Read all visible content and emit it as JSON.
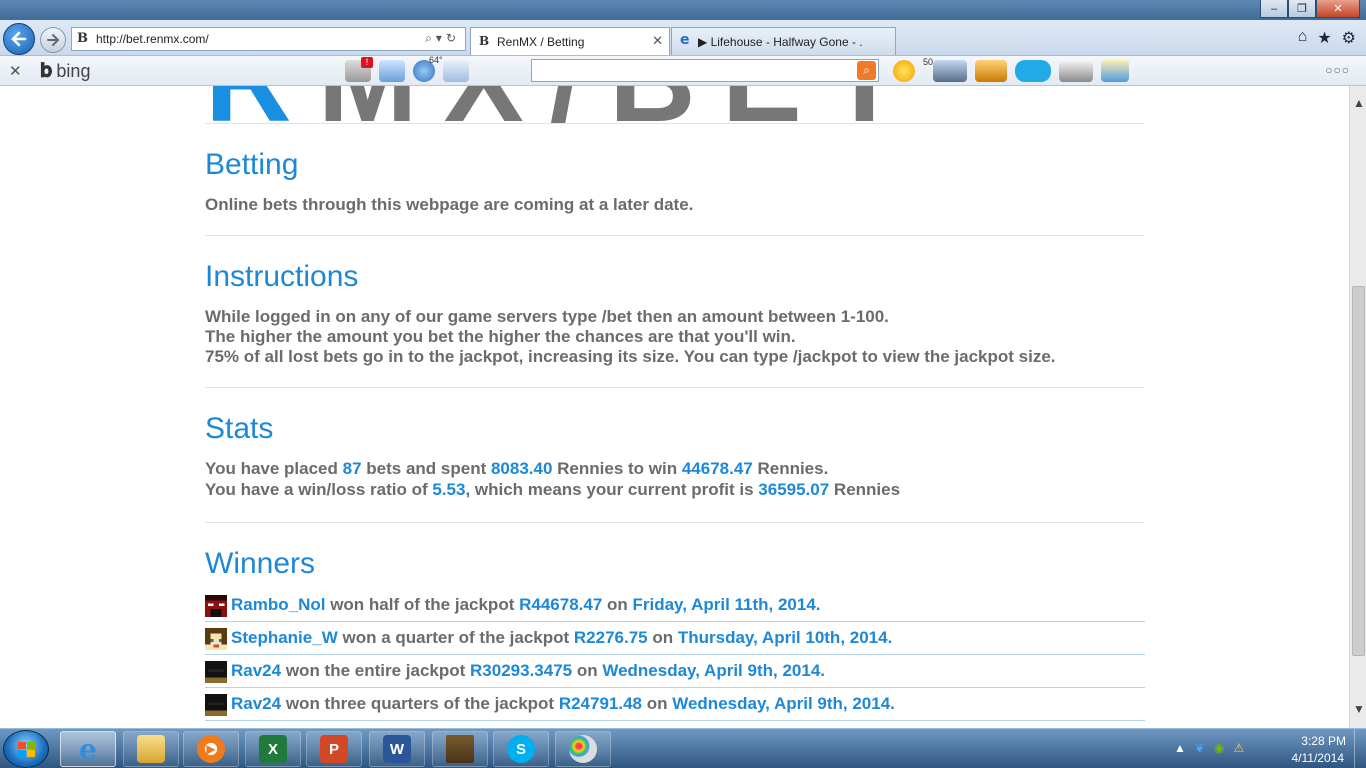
{
  "browser": {
    "address": "http://bet.renmx.com/",
    "tabs": [
      {
        "label": "RenMX / Betting"
      },
      {
        "label": "▶ Lifehouse - Halfway Gone - ..."
      }
    ],
    "toolbar_brand": "bing",
    "weather_temp": "64°",
    "badge_count": "50"
  },
  "page": {
    "sections": {
      "betting": {
        "title": "Betting",
        "text": "Online bets through this webpage are coming at a later date."
      },
      "instructions": {
        "title": "Instructions",
        "lines": [
          "While logged in on any of our game servers type /bet then an amount between 1-100.",
          "The higher the amount you bet the higher the chances are that you'll win.",
          "75% of all lost bets go in to the jackpot, increasing its size. You can type /jackpot to view the jackpot size."
        ]
      },
      "stats": {
        "title": "Stats",
        "line1": {
          "a": "You have placed ",
          "bets": "87",
          "b": " bets and spent ",
          "spent": "8083.40",
          "c": " Rennies to win ",
          "won": "44678.47",
          "d": " Rennies."
        },
        "line2": {
          "a": "You have a win/loss ratio of ",
          "ratio": "5.53",
          "b": ", which means your current profit is ",
          "profit": "36595.07",
          "c": " Rennies"
        }
      },
      "winners": {
        "title": "Winners",
        "rows": [
          {
            "name": "Rambo_Nol",
            "mid": " won half of the jackpot ",
            "amount": "R44678.47",
            "on": " on ",
            "date": "Friday, April 11th, 2014."
          },
          {
            "name": "Stephanie_W",
            "mid": " won a quarter of the jackpot ",
            "amount": "R2276.75",
            "on": " on ",
            "date": "Thursday, April 10th, 2014."
          },
          {
            "name": "Rav24",
            "mid": " won the entire jackpot ",
            "amount": "R30293.3475",
            "on": " on ",
            "date": "Wednesday, April 9th, 2014."
          },
          {
            "name": "Rav24",
            "mid": " won three quarters of the jackpot ",
            "amount": "R24791.48",
            "on": " on ",
            "date": "Wednesday, April 9th, 2014."
          }
        ]
      }
    }
  },
  "taskbar": {
    "time": "3:28 PM",
    "date": "4/11/2014"
  },
  "colors": {
    "accent": "#1e88d8",
    "text": "#6b6b6b"
  }
}
